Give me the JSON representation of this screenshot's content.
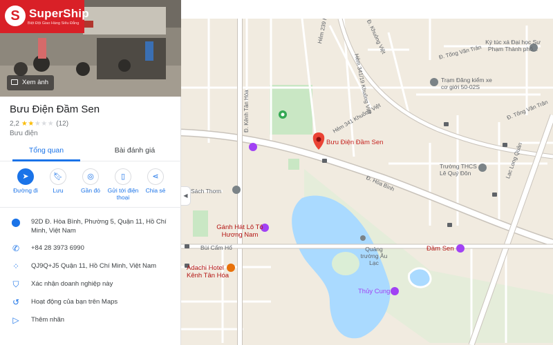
{
  "brand": {
    "name": "SuperShip",
    "mark": "S",
    "tagline": "Biệt Đội Giao Hàng Siêu Đẳng"
  },
  "photo": {
    "button_label": "Xem ảnh"
  },
  "place": {
    "title": "Bưu Điện Đầm Sen",
    "rating": "2,2",
    "stars_filled": 2,
    "stars_total": 5,
    "review_count": "(12)",
    "category": "Bưu điện"
  },
  "tabs": [
    {
      "label": "Tổng quan",
      "active": true
    },
    {
      "label": "Bài đánh giá",
      "active": false
    }
  ],
  "actions": [
    {
      "label": "Đường đi",
      "icon": "directions-icon"
    },
    {
      "label": "Lưu",
      "icon": "bookmark-icon"
    },
    {
      "label": "Gần đó",
      "icon": "nearby-icon"
    },
    {
      "label": "Gửi tới điện thoại",
      "icon": "send-to-phone-icon"
    },
    {
      "label": "Chia sẻ",
      "icon": "share-icon"
    }
  ],
  "info": [
    {
      "icon": "location-pin-icon",
      "text": "92D Đ. Hòa Bình, Phường 5, Quận 11, Hồ Chí Minh, Việt Nam"
    },
    {
      "icon": "phone-icon",
      "text": "+84 28 3973 6990"
    },
    {
      "icon": "plus-code-icon",
      "text": "QJ9Q+J5 Quận 11, Hồ Chí Minh, Việt Nam"
    },
    {
      "icon": "verified-shield-icon",
      "text": "Xác nhận doanh nghiệp này"
    },
    {
      "icon": "history-icon",
      "text": "Hoạt động của bạn trên Maps"
    },
    {
      "icon": "label-icon",
      "text": "Thêm nhãn"
    }
  ],
  "map": {
    "selected_place": "Bưu Điện Đầm Sen",
    "labels": {
      "ky_tuc_xa": "Ký túc xá Đại học Sư Phạm Thành phố...",
      "tram_dang_kiem": "Trạm Đăng kiểm xe cơ giới 50-02S",
      "truong_thcs": "Trường THCS Lê Quý Đôn",
      "sach_thom": "Sách Thơm",
      "ganh_hat": "Gánh Hát Lô Tô Hương Nam",
      "bui_cam_ho": "Bùi Cẩm Hổ",
      "adachi": "Adachi Hotel Kênh Tân Hóa",
      "quang_truong": "Quảng trường Âu Lạc",
      "dam_sen": "Đầm Sen",
      "thuy_cung": "Thủy Cung"
    },
    "roads": {
      "khuong_viet_1": "Hẻm 239 Khuông Việt",
      "khuong_viet_2": "Hẻm 341 Khuông Việt",
      "khuong_viet_3": "Hẻm 341/19 Khuông Việt",
      "khuong_viet_4": "Đ. Khuông Việt",
      "kenh_tan_hoa": "Đ. Kênh Tân Hóa",
      "hoa_binh": "Đ. Hòa Bình",
      "tong_van_tran_1": "Đ. Tống Văn Trân",
      "tong_van_tran_2": "Đ. Tống Văn Trân",
      "lac_long_quan": "Lạc Long Quân",
      "hem_341_kv": "Hẻm 341 Khuông Việt"
    }
  },
  "colors": {
    "brand_red": "#d92027",
    "accent_blue": "#1a73e8",
    "map_land": "#f1ebe0",
    "map_water": "#aadaff",
    "map_park": "#c9e7c4",
    "pin_red": "#ea4335"
  }
}
